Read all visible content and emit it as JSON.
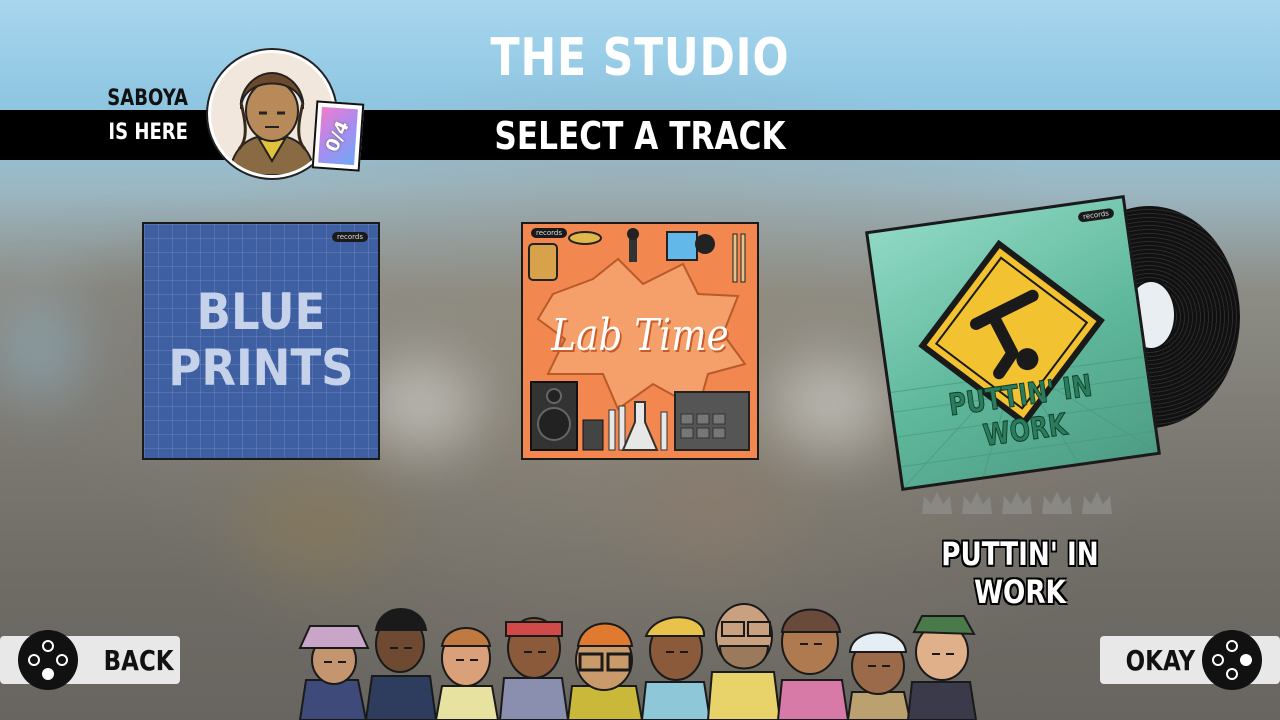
{
  "title": "THE STUDIO",
  "subtitle": "SELECT A TRACK",
  "player": {
    "name": "SABOYA",
    "status": "IS HERE",
    "card_count": "0/4"
  },
  "albums": [
    {
      "title_line1": "BLUE",
      "title_line2": "PRINTS",
      "label": "records"
    },
    {
      "title": "Lab Time",
      "label": "records"
    },
    {
      "title": "PUTTIN' IN WORK",
      "label": "records"
    }
  ],
  "selected_track": {
    "name": "PUTTIN' IN WORK",
    "rating_max": 5,
    "rating_filled": 0
  },
  "buttons": {
    "back": "BACK",
    "okay": "OKAY"
  },
  "colors": {
    "accent": "#000000",
    "blueprint": "#3f5fa3",
    "lab_orange": "#f2874f",
    "putt_green": "#5fb89b",
    "sign_yellow": "#f2c230"
  },
  "icons": [
    "controller-face-buttons-icon",
    "crown-icon",
    "stick-figure-sign-icon"
  ]
}
